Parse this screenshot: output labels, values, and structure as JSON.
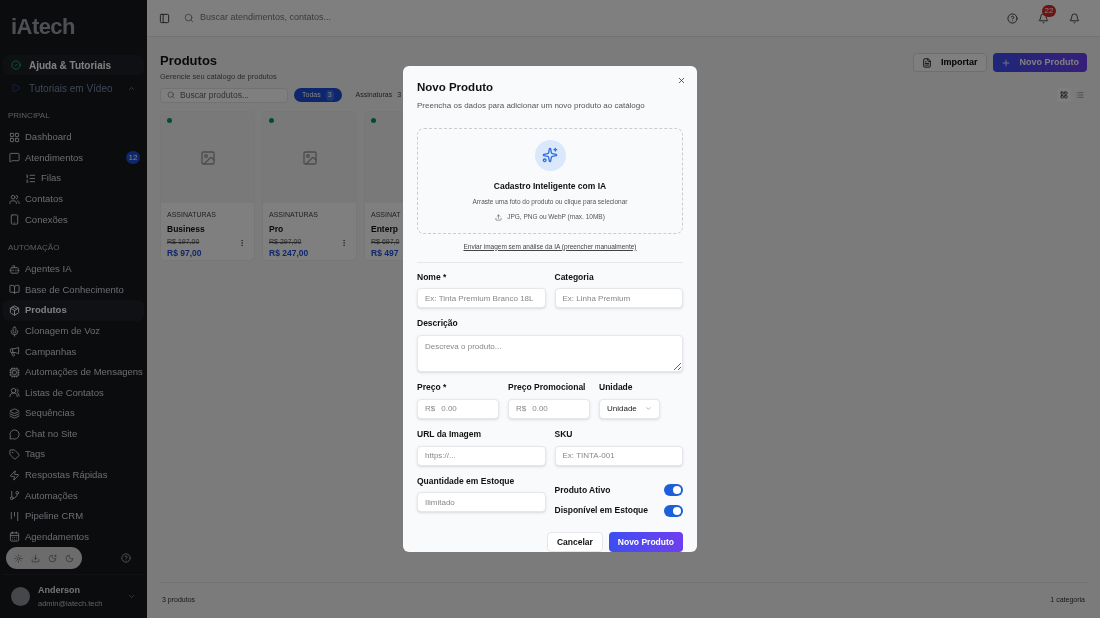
{
  "sidebar": {
    "logo": "iAtech",
    "help": [
      {
        "label": "Ajuda & Tutoriais",
        "kind": "help"
      },
      {
        "label": "Tutoriais em Vídeo",
        "kind": "video"
      }
    ],
    "sections": [
      {
        "title": "PRINCIPAL",
        "items": [
          {
            "label": "Dashboard",
            "selected": false
          },
          {
            "label": "Atendimentos",
            "selected": false,
            "badge": "12",
            "children": [
              {
                "label": "Filas",
                "selected": false
              }
            ]
          },
          {
            "label": "Contatos",
            "selected": false
          },
          {
            "label": "Conexões",
            "selected": false
          }
        ]
      },
      {
        "title": "AUTOMAÇÃO",
        "items": [
          {
            "label": "Agentes IA",
            "selected": false
          },
          {
            "label": "Base de Conhecimento",
            "selected": false
          },
          {
            "label": "Produtos",
            "selected": true
          },
          {
            "label": "Clonagem de Voz",
            "selected": false
          },
          {
            "label": "Campanhas",
            "selected": false
          },
          {
            "label": "Automações de Mensagens",
            "selected": false
          },
          {
            "label": "Listas de Contatos",
            "selected": false
          },
          {
            "label": "Sequências",
            "selected": false
          },
          {
            "label": "Chat no Site",
            "selected": false
          },
          {
            "label": "Tags",
            "selected": false
          },
          {
            "label": "Respostas Rápidas",
            "selected": false
          },
          {
            "label": "Automações",
            "selected": false
          },
          {
            "label": "Pipeline CRM",
            "selected": false
          },
          {
            "label": "Agendamentos",
            "selected": false
          }
        ]
      }
    ],
    "user": {
      "name": "Anderson",
      "email": "admin@iatech.tech"
    }
  },
  "topbar": {
    "search_placeholder": "Buscar atendimentos, contatos...",
    "notifications": "22"
  },
  "page": {
    "title": "Produtos",
    "subtitle": "Gerencie seu catálogo de produtos",
    "import_button": "Importar",
    "new_button": "Novo Produto",
    "search_placeholder": "Buscar produtos...",
    "filters": [
      {
        "label": "Todas",
        "count": "3",
        "selected": true
      },
      {
        "label": "Assinaturas",
        "count": "3",
        "selected": false
      }
    ],
    "products": [
      {
        "category": "ASSINATURAS",
        "name": "Business",
        "old_price": "R$ 197,00",
        "price": "R$ 97,00",
        "active": true,
        "menu": true,
        "image_icon": true
      },
      {
        "category": "ASSINATURAS",
        "name": "Pro",
        "old_price": "R$ 297,00",
        "price": "R$ 247,00",
        "active": true,
        "menu": true,
        "image_icon": true
      },
      {
        "category": "ASSINAT",
        "name": "Enterp",
        "old_price": "R$ 697,0",
        "price": "R$ 497",
        "active": true,
        "menu": false,
        "image_icon": false
      }
    ],
    "views": [
      {
        "kind": "grid",
        "selected": true
      },
      {
        "kind": "list",
        "selected": false
      }
    ],
    "footer_left": "3 produtos",
    "footer_right": "1 categoria"
  },
  "dialog": {
    "title": "Novo Produto",
    "subtitle": "Preencha os dados para adicionar um novo produto ao catálogo",
    "upload": {
      "title": "Cadastro Inteligente com IA",
      "hint": "Arraste uma foto do produto ou clique para selecionar",
      "formats": "JPG, PNG ou WebP (max. 10MB)"
    },
    "manual_link": "Enviar imagem sem análise da IA (preencher manualmente)",
    "name": {
      "label": "Nome *",
      "placeholder": "Ex: Tinta Premium Branco 18L"
    },
    "category": {
      "label": "Categoria",
      "placeholder": "Ex: Linha Premium"
    },
    "description": {
      "label": "Descrição",
      "placeholder": "Descreva o produto..."
    },
    "price": {
      "label": "Preço *",
      "prefix": "R$",
      "placeholder": "0.00"
    },
    "promo_price": {
      "label": "Preço Promocional",
      "prefix": "R$",
      "placeholder": "0.00"
    },
    "unit": {
      "label": "Unidade",
      "value": "Unidade"
    },
    "image_url": {
      "label": "URL da Imagem",
      "placeholder": "https://..."
    },
    "sku": {
      "label": "SKU",
      "placeholder": "Ex: TINTA-001"
    },
    "stock": {
      "label": "Quantidade em Estoque",
      "placeholder": "Ilimitado"
    },
    "toggles": [
      {
        "label": "Produto Ativo",
        "on": true
      },
      {
        "label": "Disponível em Estoque",
        "on": true
      }
    ],
    "cancel": "Cancelar",
    "submit": "Novo Produto"
  }
}
